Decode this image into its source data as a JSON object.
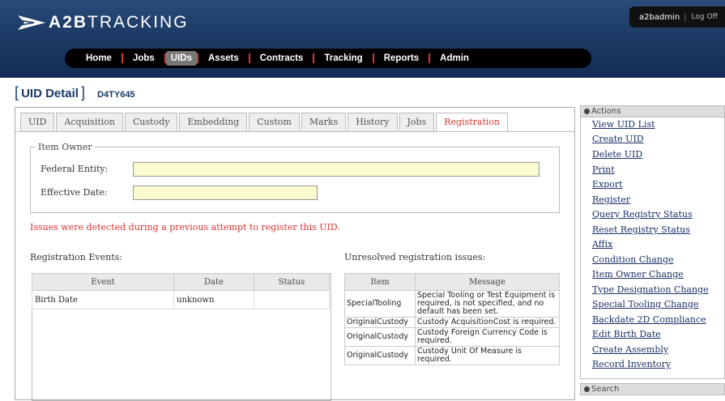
{
  "header": {
    "logo_bold": "A2B",
    "logo_rest": "TRACKING",
    "username": "a2badmin",
    "logout": "Log Off"
  },
  "nav": {
    "items": [
      "Home",
      "Jobs",
      "UIDs",
      "Assets",
      "Contracts",
      "Tracking",
      "Reports",
      "Admin"
    ],
    "active": "UIDs"
  },
  "page": {
    "title": "UID Detail",
    "uid": "D4TY645"
  },
  "tabs": [
    "UID",
    "Acquisition",
    "Custody",
    "Embedding",
    "Custom",
    "Marks",
    "History",
    "Jobs",
    "Registration"
  ],
  "active_tab": "Registration",
  "item_owner": {
    "legend": "Item Owner",
    "federal_entity_label": "Federal Entity:",
    "federal_entity_value": "",
    "effective_date_label": "Effective Date:",
    "effective_date_value": ""
  },
  "error_message": "Issues were detected during a previous attempt to register this UID.",
  "events": {
    "label": "Registration Events:",
    "columns": [
      "Event",
      "Date",
      "Status"
    ],
    "rows": [
      {
        "event": "Birth Date",
        "date": "unknown",
        "status": ""
      }
    ]
  },
  "issues": {
    "label": "Unresolved registration issues:",
    "columns": [
      "Item",
      "Message"
    ],
    "rows": [
      {
        "item": "SpecialTooling",
        "message": "Special Tooling or Test Equipment is required, is not specified, and no default has been set."
      },
      {
        "item": "OriginalCustody",
        "message": "Custody AcquisitionCost is required."
      },
      {
        "item": "OriginalCustody",
        "message": "Custody Foreign Currency Code is required."
      },
      {
        "item": "OriginalCustody",
        "message": "Custody Unit Of Measure is required."
      }
    ]
  },
  "sidebar": {
    "actions_title": "Actions",
    "actions": [
      "View UID List",
      "Create UID",
      "Delete UID",
      "Print",
      "Export",
      "Register",
      "Query Registry Status",
      "Reset Registry Status",
      "Affix",
      "Condition Change",
      "Item Owner Change",
      "Type Designation Change",
      "Special Tooling Change",
      "Backdate 2D Compliance",
      "Edit Birth Date",
      "Create Assembly",
      "Record Inventory"
    ],
    "search_title": "Search"
  },
  "colors": {
    "header_blue": "#1d3a66",
    "error_red": "#dd3333",
    "input_yellow": "#fbfbd0",
    "active_tab_red": "#dd3333"
  }
}
